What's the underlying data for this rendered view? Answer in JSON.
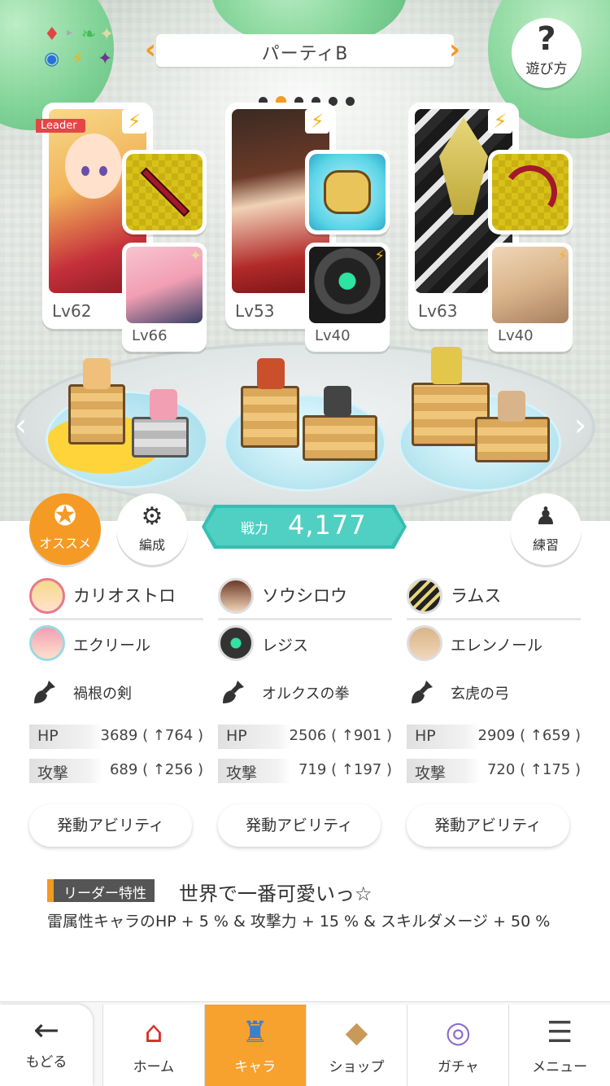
{
  "header": {
    "party_title": "パーティB",
    "page_dots": 6,
    "active_dot": 1,
    "help_label": "遊び方"
  },
  "party": [
    {
      "leader_tag": "Leader",
      "main": {
        "name": "カリオストロ",
        "level": "Lv62"
      },
      "sub": {
        "name": "エクリール",
        "level": "Lv66"
      },
      "weapon": "禍根の剣",
      "hp": "3689",
      "hp_bonus": "( ↑764 )",
      "atk": "689",
      "atk_bonus": "( ↑256 )",
      "ability_label": "発動アビリティ"
    },
    {
      "main": {
        "name": "ソウシロウ",
        "level": "Lv53"
      },
      "sub": {
        "name": "レジス",
        "level": "Lv40"
      },
      "weapon": "オルクスの拳",
      "hp": "2506",
      "hp_bonus": "( ↑901 )",
      "atk": "719",
      "atk_bonus": "( ↑197 )",
      "ability_label": "発動アビリティ"
    },
    {
      "main": {
        "name": "ラムス",
        "level": "Lv63"
      },
      "sub": {
        "name": "エレンノール",
        "level": "Lv40"
      },
      "weapon": "玄虎の弓",
      "hp": "2909",
      "hp_bonus": "( ↑659 )",
      "atk": "720",
      "atk_bonus": "( ↑175 )",
      "ability_label": "発動アビリティ"
    }
  ],
  "stat_labels": {
    "hp": "HP",
    "atk": "攻撃"
  },
  "buttons": {
    "recommend": "オススメ",
    "formation": "編成",
    "practice": "練習"
  },
  "power": {
    "label": "戦力",
    "value": "4,177"
  },
  "leader_skill": {
    "tag": "リーダー特性",
    "name": "世界で一番可愛いっ☆",
    "description": "雷属性キャラのHP + 5 % & 攻撃力 + 15 % & スキルダメージ + 50 %"
  },
  "nav": {
    "back": "もどる",
    "tabs": [
      {
        "label": "ホーム",
        "icon": "home-icon"
      },
      {
        "label": "キャラ",
        "icon": "chara-icon",
        "active": true
      },
      {
        "label": "ショップ",
        "icon": "shop-icon"
      },
      {
        "label": "ガチャ",
        "icon": "gacha-icon"
      },
      {
        "label": "メニュー",
        "icon": "menu-icon"
      }
    ]
  },
  "colors": {
    "accent": "#f59a24",
    "power": "#4fd0c3",
    "thunder": "#f3b21a",
    "leader_tag": "#e64545"
  }
}
